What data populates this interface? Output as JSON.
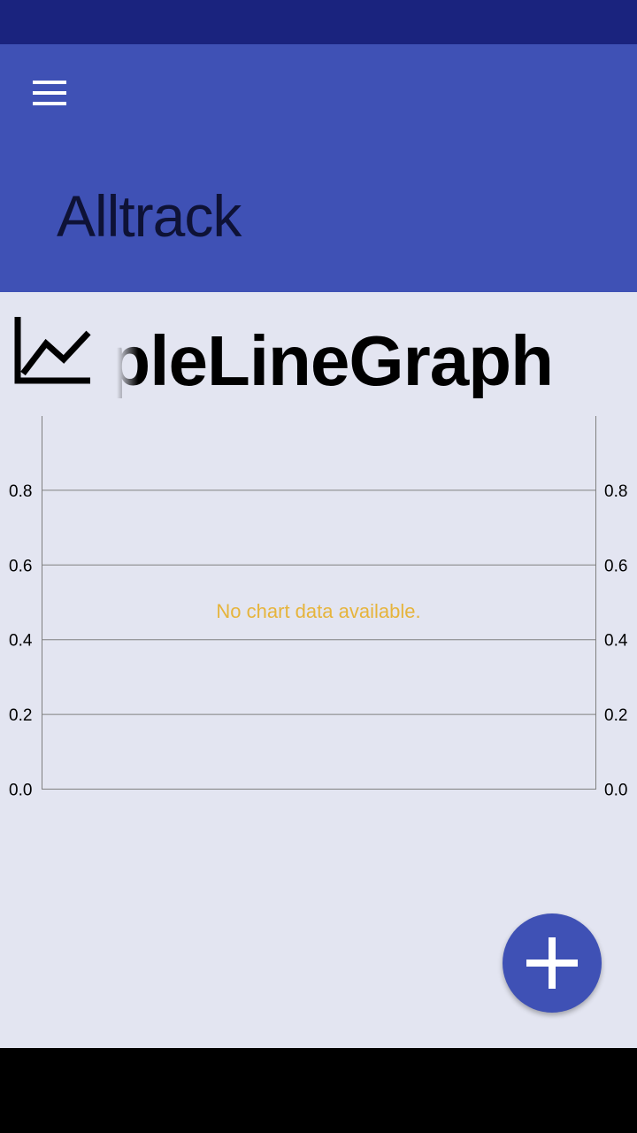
{
  "status_bar": {
    "color": "#1a237e"
  },
  "app_bar": {
    "title": "Alltrack",
    "menu_icon": "hamburger-menu-icon",
    "color": "#3f51b5",
    "title_color": "#0e1236"
  },
  "graph": {
    "icon": "line-graph-icon",
    "title": "SimpleLineGraph"
  },
  "chart_data": {
    "type": "line",
    "title": "",
    "xlabel": "",
    "ylabel": "",
    "series": [],
    "ylim": [
      0,
      1
    ],
    "left_axis_ticks": [
      "0.0",
      "0.2",
      "0.4",
      "0.6",
      "0.8"
    ],
    "right_axis_ticks": [
      "0.0",
      "0.2",
      "0.4",
      "0.6",
      "0.8"
    ],
    "grid": true,
    "empty_message": "No chart data available.",
    "empty_message_color": "#e6b43c"
  },
  "fab": {
    "icon": "plus-icon",
    "color": "#3f51b5"
  },
  "nav_bar": {
    "color": "#000000"
  }
}
